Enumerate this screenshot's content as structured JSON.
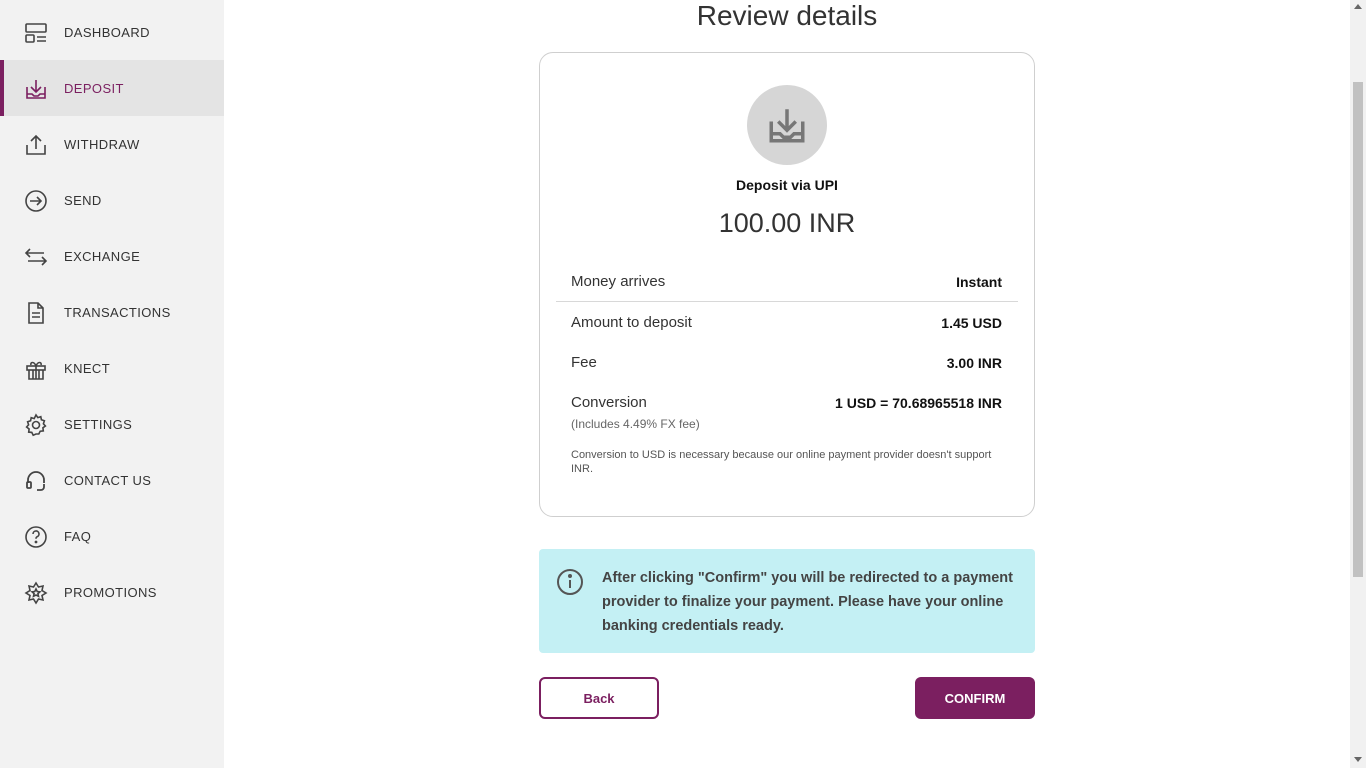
{
  "sidebar": {
    "items": [
      {
        "label": "DASHBOARD",
        "icon": "dashboard-icon"
      },
      {
        "label": "DEPOSIT",
        "icon": "deposit-icon",
        "active": true
      },
      {
        "label": "WITHDRAW",
        "icon": "withdraw-icon"
      },
      {
        "label": "SEND",
        "icon": "send-icon"
      },
      {
        "label": "EXCHANGE",
        "icon": "exchange-icon"
      },
      {
        "label": "TRANSACTIONS",
        "icon": "document-icon"
      },
      {
        "label": "KNECT",
        "icon": "gift-icon"
      },
      {
        "label": "SETTINGS",
        "icon": "gear-icon"
      },
      {
        "label": "CONTACT US",
        "icon": "headset-icon"
      },
      {
        "label": "FAQ",
        "icon": "question-icon"
      },
      {
        "label": "PROMOTIONS",
        "icon": "star-badge-icon"
      }
    ]
  },
  "page": {
    "title": "Review details"
  },
  "review": {
    "method": "Deposit via UPI",
    "amount": "100.00 INR",
    "rows": {
      "money_arrives": {
        "label": "Money arrives",
        "value": "Instant"
      },
      "amount_to_deposit": {
        "label": "Amount to deposit",
        "value": "1.45 USD"
      },
      "fee": {
        "label": "Fee",
        "value": "3.00 INR"
      },
      "conversion": {
        "label": "Conversion",
        "value": "1 USD = 70.68965518 INR",
        "sub": "(Includes 4.49% FX fee)"
      }
    },
    "note": "Conversion to USD is necessary because our online payment provider doesn't support INR."
  },
  "info": {
    "text": "After clicking \"Confirm\" you will be redirected to a payment provider to finalize your payment. Please have your online banking credentials ready."
  },
  "buttons": {
    "back": "Back",
    "confirm": "CONFIRM"
  },
  "colors": {
    "accent": "#7b1f60",
    "info_bg": "#c4f0f4",
    "sidebar_bg": "#f2f2f2"
  }
}
